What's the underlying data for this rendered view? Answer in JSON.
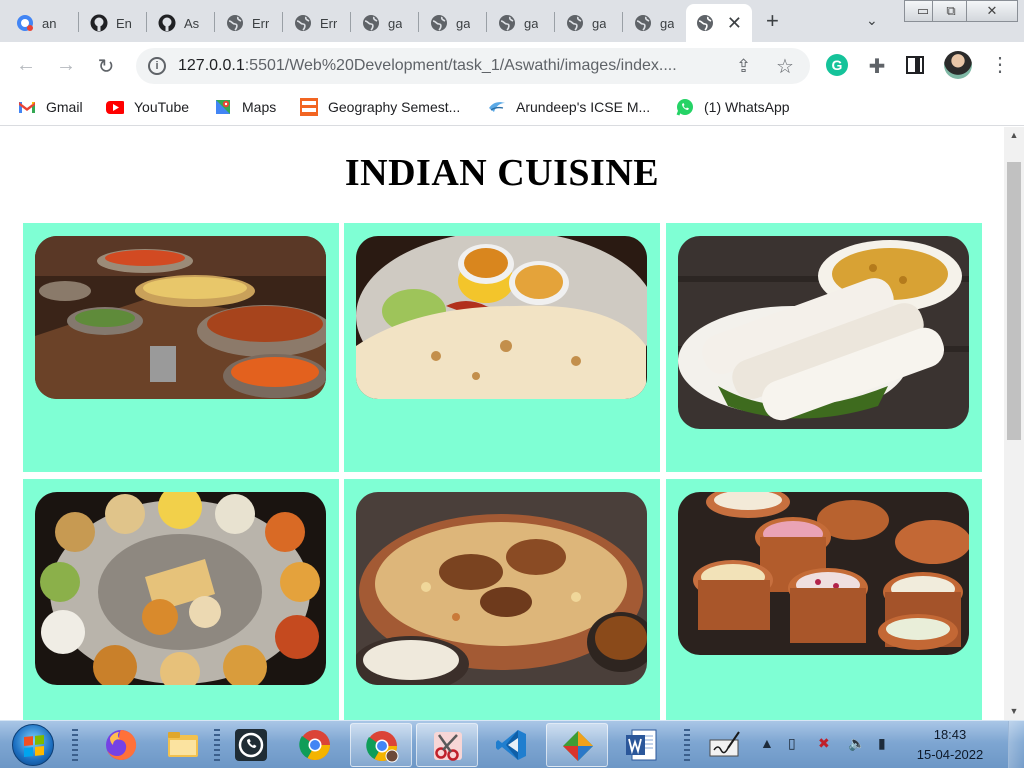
{
  "browser": {
    "tabs": [
      {
        "title": "an",
        "icon": "google-colored-tab-icon"
      },
      {
        "title": "En",
        "icon": "github-icon"
      },
      {
        "title": "As",
        "icon": "github-icon"
      },
      {
        "title": "Err",
        "icon": "globe-icon"
      },
      {
        "title": "Err",
        "icon": "globe-icon"
      },
      {
        "title": "ga",
        "icon": "globe-icon"
      },
      {
        "title": "ga",
        "icon": "globe-icon"
      },
      {
        "title": "ga",
        "icon": "globe-icon"
      },
      {
        "title": "ga",
        "icon": "globe-icon"
      },
      {
        "title": "ga",
        "icon": "globe-icon"
      },
      {
        "title": "",
        "icon": "globe-icon",
        "active": true
      }
    ],
    "new_tab_glyph": "+",
    "tab_menu_glyph": "⌄",
    "window_controls": {
      "minimize": "▭",
      "restore": "⧉",
      "close": "✕"
    },
    "address": {
      "host": "127.0.0.1",
      "path": ":5501/Web%20Development/task_1/Aswathi/images/index...."
    },
    "bookmarks": [
      {
        "label": "Gmail",
        "icon": "gmail-icon"
      },
      {
        "label": "YouTube",
        "icon": "youtube-icon"
      },
      {
        "label": "Maps",
        "icon": "maps-icon"
      },
      {
        "label": "Geography Semest...",
        "icon": "icse-help-icon"
      },
      {
        "label": "Arundeep's ICSE M...",
        "icon": "arundeep-icon"
      },
      {
        "label": "(1) WhatsApp",
        "icon": "whatsapp-icon"
      }
    ],
    "ext_grammarly": "G"
  },
  "page": {
    "title": "INDIAN CUISINE",
    "dishes": [
      {
        "depicts": "buffet-spread"
      },
      {
        "depicts": "naan-curry-plate"
      },
      {
        "depicts": "puttu-kadala"
      },
      {
        "depicts": "thali-platter"
      },
      {
        "depicts": "biryani-pot"
      },
      {
        "depicts": "kulfi-clay-pots"
      }
    ]
  },
  "taskbar": {
    "apps": [
      "firefox",
      "file-explorer",
      "whatsapp",
      "chrome",
      "chrome-profile",
      "snipping-tool",
      "vs-code",
      "app-store",
      "word",
      "notepad-sign"
    ],
    "clock_time": "18:43",
    "clock_date": "15-04-2022"
  },
  "colors": {
    "card_bg": "#7fffd4",
    "tabstrip_bg": "#dee1e6",
    "taskbar_top": "#a9c6e6"
  }
}
